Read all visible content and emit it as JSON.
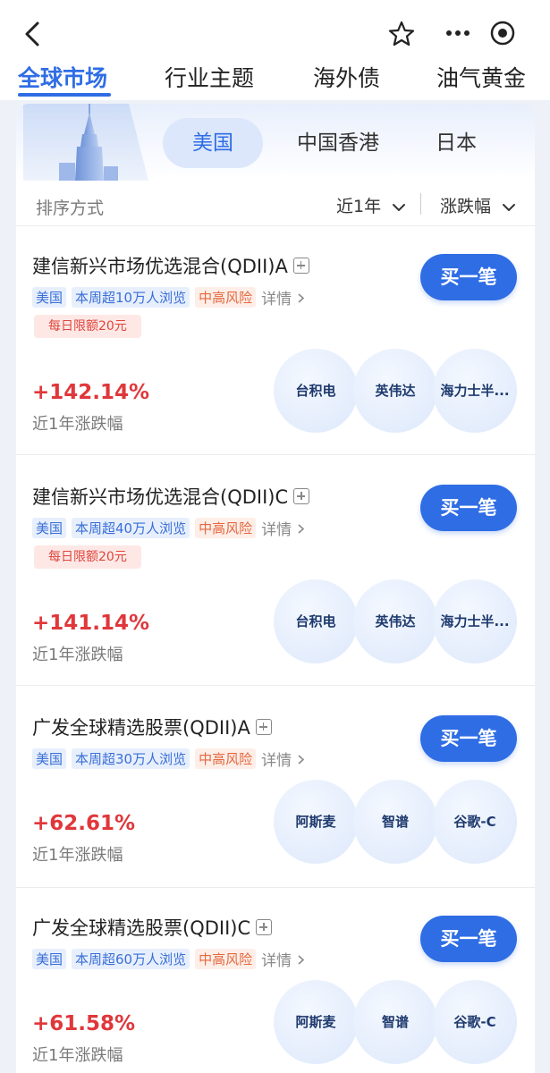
{
  "nav": {
    "tabs": [
      {
        "label": "全球市场"
      },
      {
        "label": "行业主题"
      },
      {
        "label": "海外债"
      },
      {
        "label": "油气黄金"
      }
    ]
  },
  "regions": {
    "tabs": [
      {
        "label": "美国"
      },
      {
        "label": "中国香港"
      },
      {
        "label": "日本"
      }
    ]
  },
  "sort": {
    "label": "排序方式",
    "period": "近1年",
    "metric": "涨跌幅"
  },
  "funds": [
    {
      "name": "建信新兴市场优选混合(QDII)A",
      "tags": [
        "美国",
        "本周超10万人浏览"
      ],
      "risk": "中高风险",
      "detail": "详情",
      "limit": "每日限额20元",
      "buy": "买一笔",
      "return_value": "+142.14%",
      "return_label": "近1年涨跌幅",
      "holdings": [
        "台积电",
        "英伟达",
        "海力士半..."
      ]
    },
    {
      "name": "建信新兴市场优选混合(QDII)C",
      "tags": [
        "美国",
        "本周超40万人浏览"
      ],
      "risk": "中高风险",
      "detail": "详情",
      "limit": "每日限额20元",
      "buy": "买一笔",
      "return_value": "+141.14%",
      "return_label": "近1年涨跌幅",
      "holdings": [
        "台积电",
        "英伟达",
        "海力士半..."
      ]
    },
    {
      "name": "广发全球精选股票(QDII)A",
      "tags": [
        "美国",
        "本周超30万人浏览"
      ],
      "risk": "中高风险",
      "detail": "详情",
      "buy": "买一笔",
      "return_value": "+62.61%",
      "return_label": "近1年涨跌幅",
      "holdings": [
        "阿斯麦",
        "智谱",
        "谷歌-C"
      ]
    },
    {
      "name": "广发全球精选股票(QDII)C",
      "tags": [
        "美国",
        "本周超60万人浏览"
      ],
      "risk": "中高风险",
      "detail": "详情",
      "buy": "买一笔",
      "return_value": "+61.58%",
      "return_label": "近1年涨跌幅",
      "holdings": [
        "阿斯麦",
        "智谱",
        "谷歌-C"
      ]
    }
  ],
  "colors": {
    "accent": "#2f6de5",
    "positive": "#e0373b",
    "risk": "#e5673e"
  }
}
